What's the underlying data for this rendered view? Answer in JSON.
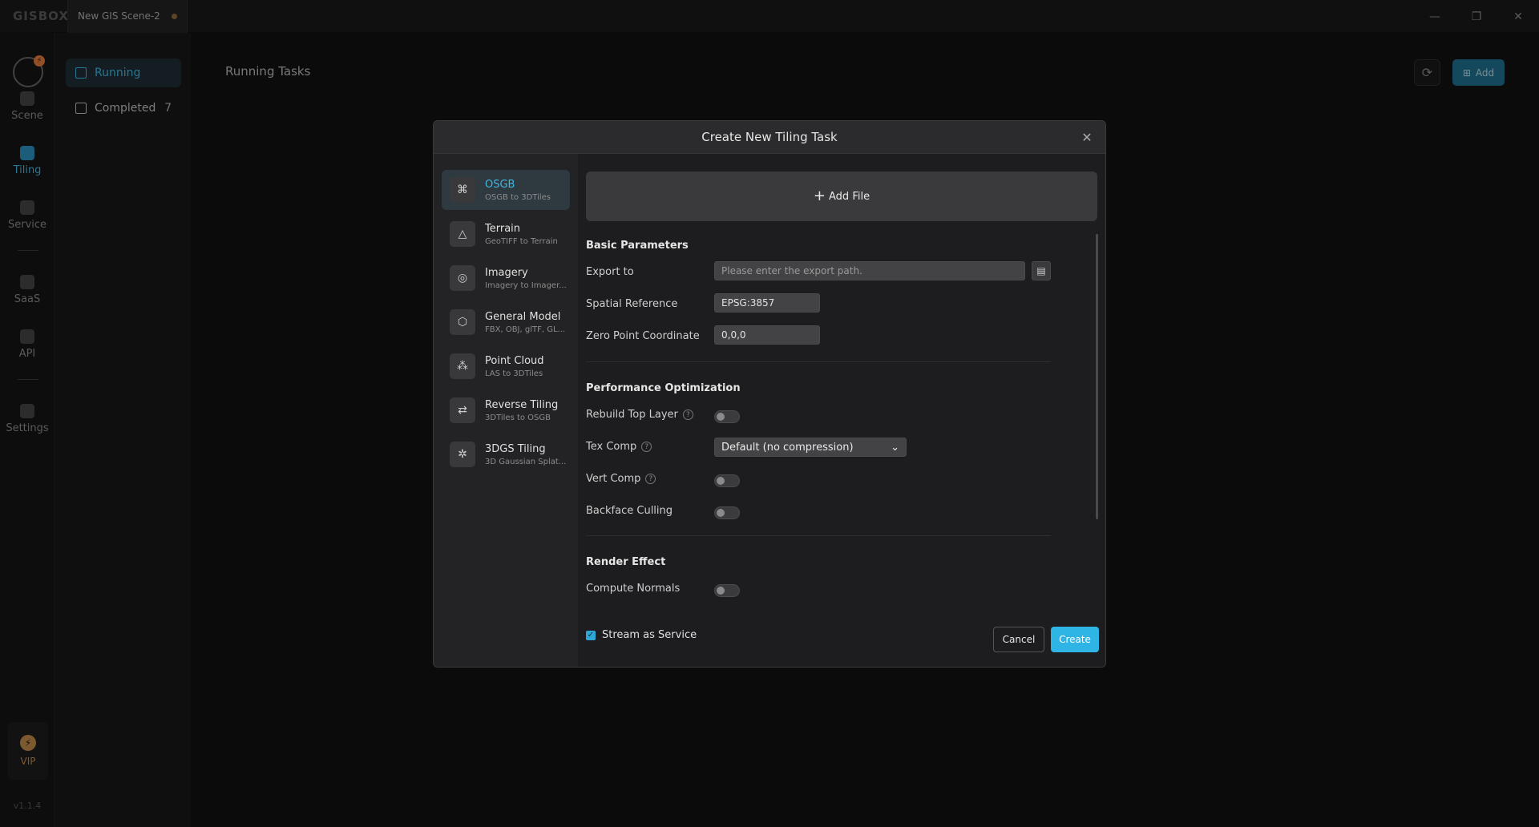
{
  "app": {
    "logo": "GISBOX",
    "scene_tab": "New GIS Scene-2",
    "window_controls": [
      "—",
      "❐",
      "✕"
    ]
  },
  "rail": {
    "items": [
      {
        "label": "Scene",
        "icon": "scene-icon"
      },
      {
        "label": "Tiling",
        "icon": "tiling-icon"
      },
      {
        "label": "Service",
        "icon": "service-icon"
      },
      {
        "label": "SaaS",
        "icon": "saas-icon"
      },
      {
        "label": "API",
        "icon": "api-icon"
      },
      {
        "label": "Settings",
        "icon": "settings-icon"
      }
    ],
    "vip_label": "VIP",
    "version": "v1.1.4",
    "accent": "#3fb7e3"
  },
  "subnav": {
    "running": "Running",
    "completed": "Completed",
    "completed_count": "7"
  },
  "main": {
    "title": "Running Tasks",
    "add_label": "Add"
  },
  "dialog": {
    "title": "Create New Tiling Task",
    "types": [
      {
        "name": "OSGB",
        "desc": "OSGB to 3DTiles",
        "icon": "osgb-icon",
        "glyph": "⌘"
      },
      {
        "name": "Terrain",
        "desc": "GeoTIFF to Terrain",
        "icon": "terrain-icon",
        "glyph": "△"
      },
      {
        "name": "Imagery",
        "desc": "Imagery to Imager...",
        "icon": "imagery-icon",
        "glyph": "◎"
      },
      {
        "name": "General Model",
        "desc": "FBX, OBJ, glTF, GL...",
        "icon": "model-icon",
        "glyph": "⬡"
      },
      {
        "name": "Point Cloud",
        "desc": "LAS to 3DTiles",
        "icon": "point-cloud-icon",
        "glyph": "⁂"
      },
      {
        "name": "Reverse Tiling",
        "desc": "3DTiles to OSGB",
        "icon": "reverse-tiling-icon",
        "glyph": "⇄"
      },
      {
        "name": "3DGS Tiling",
        "desc": "3D Gaussian Splat...",
        "icon": "3dgs-icon",
        "glyph": "✲"
      }
    ],
    "add_file": "Add File",
    "basic_title": "Basic Parameters",
    "export_label": "Export to",
    "export_placeholder": "Please enter the export path.",
    "spatial_label": "Spatial Reference",
    "spatial_value": "EPSG:3857",
    "zero_label": "Zero Point Coordinate",
    "zero_value": "0,0,0",
    "perf_title": "Performance Optimization",
    "rebuild_label": "Rebuild Top Layer",
    "texcomp_label": "Tex Comp",
    "texcomp_value": "Default (no compression)",
    "vertcomp_label": "Vert Comp",
    "backface_label": "Backface Culling",
    "render_title": "Render Effect",
    "normals_label": "Compute Normals",
    "stream_label": "Stream as Service",
    "cancel_label": "Cancel",
    "create_label": "Create"
  }
}
